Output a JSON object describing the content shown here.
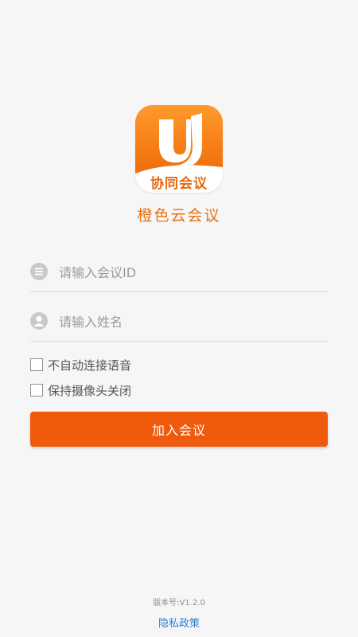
{
  "logo": {
    "text": "协同会议",
    "icon": "u-logo-icon",
    "colors": {
      "primary": "#f47a12",
      "dark": "#e8610a"
    }
  },
  "app": {
    "name": "橙色云会议"
  },
  "form": {
    "meeting_id": {
      "placeholder": "请输入会议ID",
      "value": "",
      "icon": "list-circle-icon"
    },
    "user_name": {
      "placeholder": "请输入姓名",
      "value": "",
      "icon": "person-circle-icon"
    },
    "options": [
      {
        "label": "不自动连接语音",
        "checked": false
      },
      {
        "label": "保持摄像头关闭",
        "checked": false
      }
    ],
    "join_label": "加入会议",
    "accent": "#f05a0c"
  },
  "footer": {
    "version": "版本号:V1.2.0",
    "privacy_link": "隐私政策",
    "link_color": "#2f7fd8"
  }
}
